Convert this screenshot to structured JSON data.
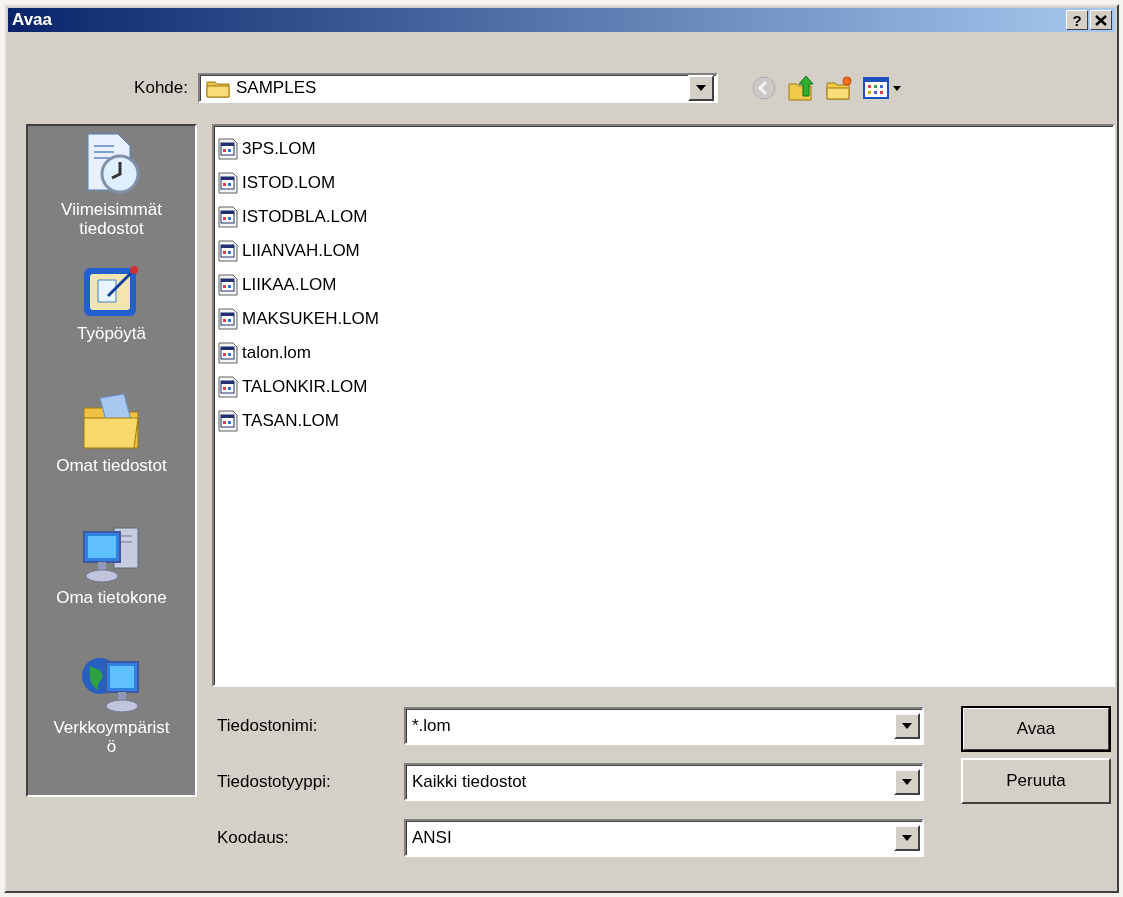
{
  "window": {
    "title": "Avaa",
    "help": "?"
  },
  "look_in": {
    "label": "Kohde:",
    "value": "SAMPLES"
  },
  "toolbar": [
    {
      "kind": "back",
      "disabled": true
    },
    {
      "kind": "up",
      "disabled": false
    },
    {
      "kind": "new_folder",
      "disabled": false
    },
    {
      "kind": "views",
      "disabled": false
    }
  ],
  "places": [
    {
      "kind": "recent",
      "label": "Viimeisimmät tiedostot"
    },
    {
      "kind": "desktop",
      "label": "Työpöytä"
    },
    {
      "kind": "documents",
      "label": "Omat tiedostot"
    },
    {
      "kind": "computer",
      "label": "Oma tietokone"
    },
    {
      "kind": "network",
      "label": "Verkkoympäristö"
    }
  ],
  "files": [
    "3PS.LOM",
    "ISTOD.LOM",
    "ISTODBLA.LOM",
    "LIIANVAH.LOM",
    "LIIKAA.LOM",
    "MAKSUKEH.LOM",
    "talon.lom",
    "TALONKIR.LOM",
    "TASAN.LOM"
  ],
  "fields": [
    {
      "label": "Tiedostonimi:",
      "value": "*.lom"
    },
    {
      "label": "Tiedostotyyppi:",
      "value": "Kaikki tiedostot"
    },
    {
      "label": "Koodaus:",
      "value": "ANSI"
    }
  ],
  "buttons": [
    {
      "label": "Avaa",
      "default": true
    },
    {
      "label": "Peruuta",
      "default": false
    }
  ]
}
